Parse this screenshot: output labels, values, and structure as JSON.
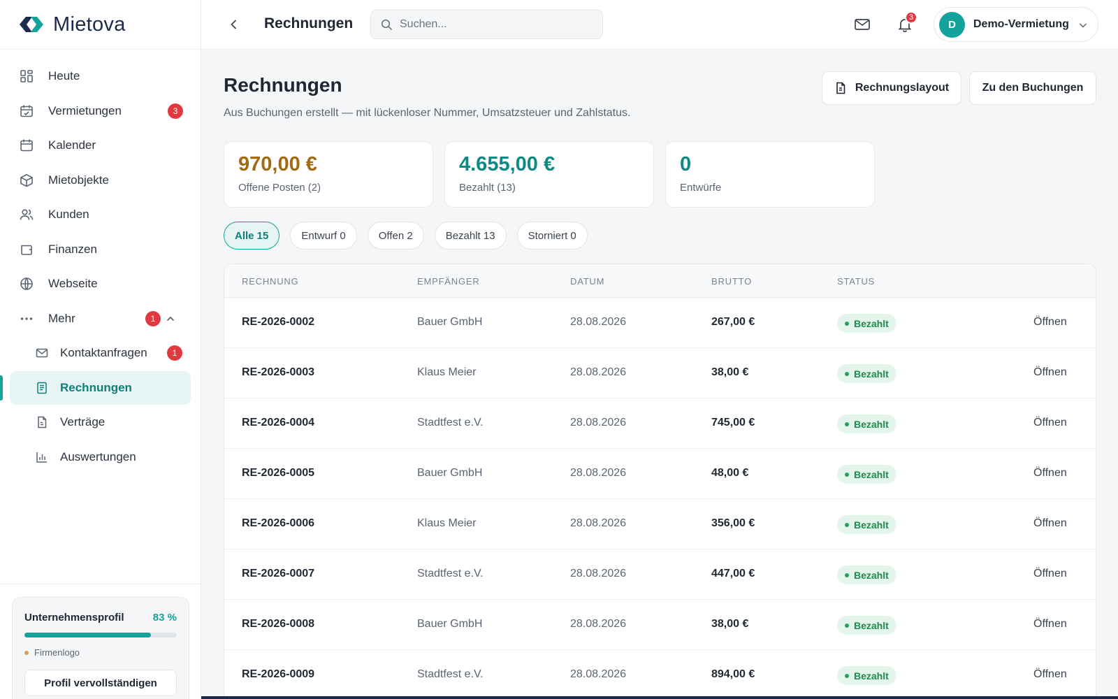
{
  "app": {
    "name": "Mietova"
  },
  "sidebar": {
    "items": [
      {
        "label": "Heute",
        "icon": "grid-icon"
      },
      {
        "label": "Vermietungen",
        "icon": "calendar-check-icon",
        "badge": "3"
      },
      {
        "label": "Kalender",
        "icon": "calendar-icon"
      },
      {
        "label": "Mietobjekte",
        "icon": "box-icon"
      },
      {
        "label": "Kunden",
        "icon": "users-icon"
      },
      {
        "label": "Finanzen",
        "icon": "wallet-icon"
      },
      {
        "label": "Webseite",
        "icon": "globe-icon"
      },
      {
        "label": "Mehr",
        "icon": "more-icon",
        "badge": "1"
      }
    ],
    "subitems": [
      {
        "label": "Kontaktanfragen",
        "icon": "mail-icon",
        "badge": "1"
      },
      {
        "label": "Rechnungen",
        "icon": "invoice-icon",
        "active": true
      },
      {
        "label": "Verträge",
        "icon": "contract-icon"
      },
      {
        "label": "Auswertungen",
        "icon": "bar-chart-icon"
      }
    ],
    "profile": {
      "title": "Unternehmensprofil",
      "percent_label": "83 %",
      "progress": 0.83,
      "missing_item": "Firmenlogo",
      "button": "Profil vervollständigen"
    }
  },
  "topbar": {
    "title": "Rechnungen",
    "search_placeholder": "Suchen...",
    "notification_count": "3",
    "account_initial": "D",
    "account_name": "Demo-Vermietung"
  },
  "page": {
    "title": "Rechnungen",
    "subtitle": "Aus Buchungen erstellt — mit lückenloser Nummer, Umsatzsteuer und Zahlstatus.",
    "buttons": {
      "layout": "Rechnungslayout",
      "bookings": "Zu den Buchungen"
    },
    "kpis": [
      {
        "value": "970,00 €",
        "caption": "Offene Posten (2)",
        "color": "#a26b12"
      },
      {
        "value": "4.655,00 €",
        "caption": "Bezahlt (13)",
        "color": "#0e8a84"
      },
      {
        "value": "0",
        "caption": "Entwürfe",
        "color": "#0e8a84"
      }
    ],
    "filters": [
      "Alle 15",
      "Entwurf 0",
      "Offen 2",
      "Bezahlt 13",
      "Storniert 0"
    ]
  },
  "table": {
    "columns": [
      "RECHNUNG",
      "EMPFÄNGER",
      "DATUM",
      "BRUTTO",
      "STATUS"
    ],
    "action_label": "Öffnen",
    "rows": [
      {
        "nr": "RE-2026-0002",
        "recipient": "Bauer GmbH",
        "date": "28.08.2026",
        "gross": "267,00 €",
        "status": "Bezahlt"
      },
      {
        "nr": "RE-2026-0003",
        "recipient": "Klaus Meier",
        "date": "28.08.2026",
        "gross": "38,00 €",
        "status": "Bezahlt"
      },
      {
        "nr": "RE-2026-0004",
        "recipient": "Stadtfest e.V.",
        "date": "28.08.2026",
        "gross": "745,00 €",
        "status": "Bezahlt"
      },
      {
        "nr": "RE-2026-0005",
        "recipient": "Bauer GmbH",
        "date": "28.08.2026",
        "gross": "48,00 €",
        "status": "Bezahlt"
      },
      {
        "nr": "RE-2026-0006",
        "recipient": "Klaus Meier",
        "date": "28.08.2026",
        "gross": "356,00 €",
        "status": "Bezahlt"
      },
      {
        "nr": "RE-2026-0007",
        "recipient": "Stadtfest e.V.",
        "date": "28.08.2026",
        "gross": "447,00 €",
        "status": "Bezahlt"
      },
      {
        "nr": "RE-2026-0008",
        "recipient": "Bauer GmbH",
        "date": "28.08.2026",
        "gross": "38,00 €",
        "status": "Bezahlt"
      },
      {
        "nr": "RE-2026-0009",
        "recipient": "Stadtfest e.V.",
        "date": "28.08.2026",
        "gross": "894,00 €",
        "status": "Bezahlt"
      }
    ]
  }
}
